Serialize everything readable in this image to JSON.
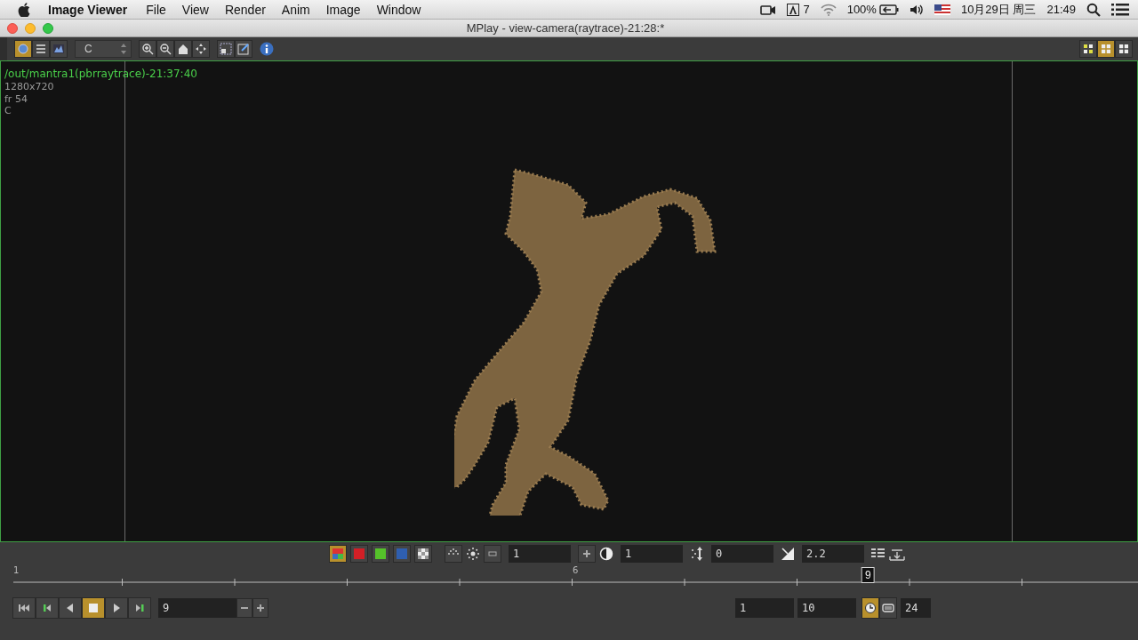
{
  "menu_bar": {
    "app_name": "Image Viewer",
    "menus": [
      "File",
      "View",
      "Render",
      "Anim",
      "Image",
      "Window"
    ],
    "status": {
      "notification_count": "7",
      "battery": "100%",
      "date": "10月29日 周三",
      "time": "21:49"
    }
  },
  "window": {
    "title": "MPlay - view-camera(raytrace)-21:28:*"
  },
  "toolbar": {
    "view_modes": [
      {
        "kind": "render",
        "selected": true
      },
      {
        "kind": "list",
        "selected": false
      },
      {
        "kind": "histogram",
        "selected": false
      }
    ],
    "channel": {
      "value": "C"
    },
    "layouts": [
      {
        "kind": "quad",
        "selected": false
      },
      {
        "kind": "split",
        "selected": true
      },
      {
        "kind": "single",
        "selected": false
      }
    ]
  },
  "viewport": {
    "source": "/out/mantra1(pbrraytrace)-21:37:40",
    "resolution": "1280x720",
    "frame": "fr 54",
    "plane": "C"
  },
  "display_bar": {
    "channels": [
      {
        "kind": "rgb",
        "selected": true
      },
      {
        "kind": "red",
        "selected": false
      },
      {
        "kind": "green",
        "selected": false
      },
      {
        "kind": "blue",
        "selected": false
      },
      {
        "kind": "alpha",
        "selected": false
      }
    ],
    "fields": [
      {
        "kind": "brightness",
        "value": "1"
      },
      {
        "kind": "contrast",
        "value": "1"
      },
      {
        "kind": "offset",
        "value": "0"
      },
      {
        "kind": "gamma",
        "value": "2.2"
      }
    ]
  },
  "timeline": {
    "labels": [
      "1",
      "6"
    ],
    "current_frame": "9",
    "level": 0.76
  },
  "playback": {
    "buttons": [
      {
        "kind": "first",
        "selected": false
      },
      {
        "kind": "prev_key",
        "selected": false
      },
      {
        "kind": "reverse",
        "selected": false
      },
      {
        "kind": "stop",
        "selected": true
      },
      {
        "kind": "play",
        "selected": false
      },
      {
        "kind": "next_key",
        "selected": false
      }
    ],
    "frame": "9",
    "range_start": "1",
    "range_end": "10",
    "modes": [
      {
        "kind": "realtime",
        "selected": true
      },
      {
        "kind": "all_frames",
        "selected": false
      }
    ],
    "fps": "24"
  }
}
